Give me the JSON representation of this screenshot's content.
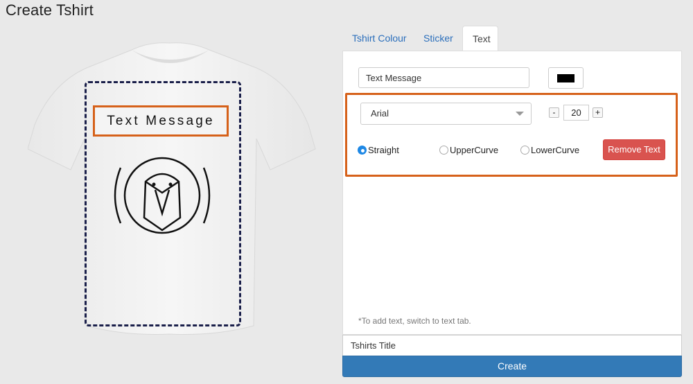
{
  "page": {
    "title": "Create Tshirt"
  },
  "preview": {
    "text_message": "Text Message",
    "tshirt_icon": "tshirt-icon",
    "logo_icon": "bird-logo-icon"
  },
  "tabs": [
    {
      "label": "Tshirt Colour",
      "active": false
    },
    {
      "label": "Sticker",
      "active": false
    },
    {
      "label": "Text",
      "active": true
    }
  ],
  "text_tab": {
    "text_value": "Text Message",
    "text_color": "#000000",
    "font": {
      "selected": "Arial"
    },
    "size": {
      "decrement_label": "-",
      "value": "20",
      "increment_label": "+"
    },
    "curve_options": [
      {
        "label": "Straight",
        "checked": true
      },
      {
        "label": "UpperCurve",
        "checked": false
      },
      {
        "label": "LowerCurve",
        "checked": false
      }
    ],
    "remove_label": "Remove Text",
    "hint": "*To add text, switch to text tab."
  },
  "footer": {
    "title_value": "Tshirts Title",
    "create_label": "Create"
  },
  "colors": {
    "accent": "#337ab7",
    "danger": "#d9534f",
    "highlight": "#d6611a",
    "link": "#2a6ebb"
  }
}
